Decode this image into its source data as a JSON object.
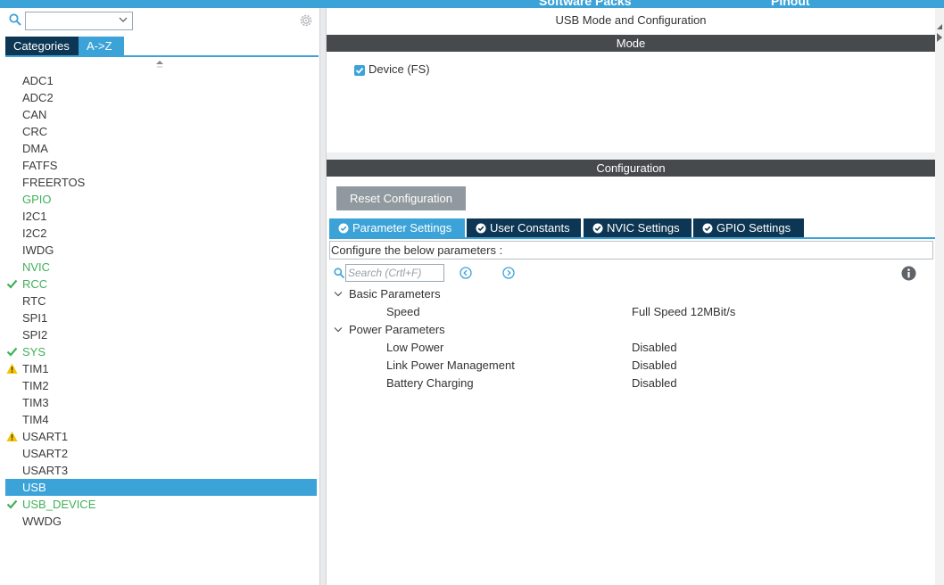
{
  "topbar": {
    "tab_software_packs": "Software Packs",
    "tab_pinout": "Pinout"
  },
  "colors": {
    "accent": "#3ca3d8",
    "dark_navy": "#0c3653",
    "header_gray": "#474a4d",
    "ok_green": "#42b05a",
    "warn_yellow": "#f5c400"
  },
  "sidebar": {
    "search_value": "",
    "tabs": [
      {
        "label": "Categories",
        "active": false
      },
      {
        "label": "A->Z",
        "active": true
      }
    ],
    "items": [
      {
        "label": "ADC1",
        "status": "none"
      },
      {
        "label": "ADC2",
        "status": "none"
      },
      {
        "label": "CAN",
        "status": "none"
      },
      {
        "label": "CRC",
        "status": "none"
      },
      {
        "label": "DMA",
        "status": "none"
      },
      {
        "label": "FATFS",
        "status": "none"
      },
      {
        "label": "FREERTOS",
        "status": "none"
      },
      {
        "label": "GPIO",
        "status": "green"
      },
      {
        "label": "I2C1",
        "status": "none"
      },
      {
        "label": "I2C2",
        "status": "none"
      },
      {
        "label": "IWDG",
        "status": "none"
      },
      {
        "label": "NVIC",
        "status": "green"
      },
      {
        "label": "RCC",
        "status": "check"
      },
      {
        "label": "RTC",
        "status": "none"
      },
      {
        "label": "SPI1",
        "status": "none"
      },
      {
        "label": "SPI2",
        "status": "none"
      },
      {
        "label": "SYS",
        "status": "check"
      },
      {
        "label": "TIM1",
        "status": "warning"
      },
      {
        "label": "TIM2",
        "status": "none"
      },
      {
        "label": "TIM3",
        "status": "none"
      },
      {
        "label": "TIM4",
        "status": "none"
      },
      {
        "label": "USART1",
        "status": "warning"
      },
      {
        "label": "USART2",
        "status": "none"
      },
      {
        "label": "USART3",
        "status": "none"
      },
      {
        "label": "USB",
        "status": "selected"
      },
      {
        "label": "USB_DEVICE",
        "status": "check"
      },
      {
        "label": "WWDG",
        "status": "none"
      }
    ]
  },
  "main": {
    "title": "USB Mode and Configuration",
    "mode": {
      "header": "Mode",
      "device_label": "Device (FS)",
      "device_checked": true
    },
    "configuration": {
      "header": "Configuration",
      "reset_button": "Reset Configuration",
      "tabs": [
        {
          "label": "Parameter Settings",
          "active": true
        },
        {
          "label": "User Constants",
          "active": false
        },
        {
          "label": "NVIC Settings",
          "active": false
        },
        {
          "label": "GPIO Settings",
          "active": false
        }
      ],
      "configure_text": "Configure the below parameters :",
      "search_placeholder": "Search (Crtl+F)",
      "groups": [
        {
          "label": "Basic Parameters",
          "params": [
            {
              "name": "Speed",
              "value": "Full Speed 12MBit/s"
            }
          ]
        },
        {
          "label": "Power Parameters",
          "params": [
            {
              "name": "Low Power",
              "value": "Disabled"
            },
            {
              "name": "Link Power Management",
              "value": "Disabled"
            },
            {
              "name": "Battery Charging",
              "value": "Disabled"
            }
          ]
        }
      ]
    }
  }
}
